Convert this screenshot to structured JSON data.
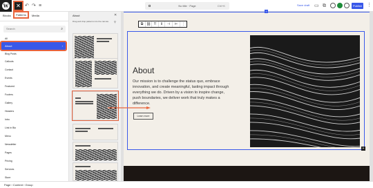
{
  "header": {
    "close_label": "✕",
    "doc_title": "No title · Page",
    "shortcut": "Ctrl+K",
    "save_draft": "Save draft",
    "publish": "Publish"
  },
  "inserter": {
    "tabs": [
      "Blocks",
      "Patterns",
      "Media"
    ],
    "active_tab": "Patterns",
    "search_placeholder": "Search",
    "categories": [
      "All",
      "About",
      "Blog Posts",
      "Callouts",
      "Contact",
      "Events",
      "Featured",
      "Footers",
      "Gallery",
      "Headers",
      "Intro",
      "Link in Bio",
      "Menu",
      "Newsletter",
      "Pages",
      "Pricing",
      "Services",
      "Store",
      "Team"
    ],
    "active_category": "About"
  },
  "patterns_panel": {
    "title": "About",
    "description": "Drag and drop patterns into the canvas."
  },
  "canvas": {
    "heading": "About",
    "body": "Our mission is to challenge the status quo, embrace innovation, and create meaningful, lasting impact through everything we do. Driven by a vision to inspire change, push boundaries, we deliver work that truly makes a difference.",
    "button": "Learn more"
  },
  "breadcrumb": "Page  ›  Content  ›  Group",
  "colors": {
    "accent": "#3858e9",
    "highlight": "#e8643c",
    "page_bg": "#f3efe8"
  }
}
